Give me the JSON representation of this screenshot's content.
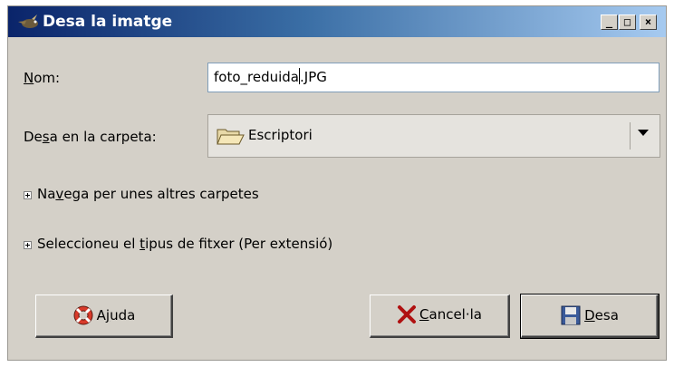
{
  "window": {
    "title": "Desa la imatge",
    "controls": {
      "minimize": "_",
      "maximize": "□",
      "close": "×"
    }
  },
  "form": {
    "name_label_mnemonic": "N",
    "name_label_rest": "om:",
    "filename_before_caret": "foto_reduida",
    "filename_after_caret": ".JPG",
    "folder_label_pre": "De",
    "folder_label_mnemonic": "s",
    "folder_label_post": "a en la carpeta:",
    "folder_value": "Escriptori"
  },
  "expanders": {
    "browse_pre": "Na",
    "browse_mnemonic": "v",
    "browse_post": "ega per unes altres carpetes",
    "filetype_pre": "Seleccioneu el ",
    "filetype_mnemonic": "t",
    "filetype_post": "ipus de fitxer (Per extensió)"
  },
  "buttons": {
    "help_pre": "A",
    "help_mnemonic": "j",
    "help_post": "uda",
    "cancel_mnemonic": "C",
    "cancel_post": "ancel·la",
    "save_mnemonic": "D",
    "save_post": "esa"
  },
  "icons": {
    "title": "gimp-wilber-icon",
    "folder": "folder-open-icon",
    "help": "lifebuoy-icon",
    "cancel": "red-x-icon",
    "save": "floppy-disk-icon"
  },
  "colors": {
    "titlebar_start": "#0a246a",
    "titlebar_end": "#a6caf0",
    "dialog_bg": "#d4d0c8",
    "input_border": "#7f9db9"
  }
}
